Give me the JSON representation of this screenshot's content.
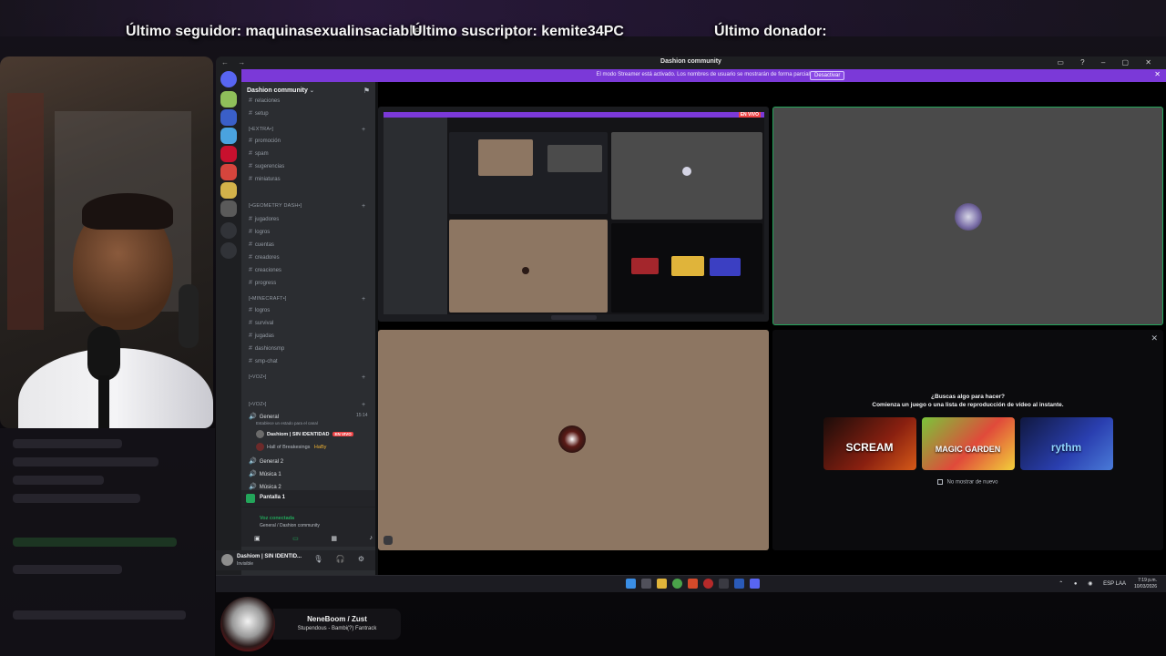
{
  "overlay": {
    "last_follower": "Último seguidor: maquinasexualinsaciable",
    "last_subscriber": "Último suscriptor: kemite34PC",
    "last_donor": "Último donador:"
  },
  "window": {
    "title": "Dashion community",
    "nav": "← →"
  },
  "banner": {
    "text": "El modo Streamer está activado. Los nombres de usuario se mostrarán de forma parcial.",
    "button": "Desactivar",
    "close": "✕"
  },
  "server": {
    "name": "Dashion community",
    "chevron": "⌄"
  },
  "channels": [
    {
      "kind": "text",
      "label": "relaciones"
    },
    {
      "kind": "text",
      "label": "setup"
    },
    {
      "kind": "cat",
      "label": "[•EXTRA•]"
    },
    {
      "kind": "text",
      "label": "promoción"
    },
    {
      "kind": "text",
      "label": "spam"
    },
    {
      "kind": "text",
      "label": "sugerencias"
    },
    {
      "kind": "text",
      "label": "miniaturas"
    },
    {
      "kind": "cat",
      "label": "[•GEOMETRY DASH•]"
    },
    {
      "kind": "text",
      "label": "jugadores"
    },
    {
      "kind": "text",
      "label": "logros"
    },
    {
      "kind": "text",
      "label": "cuentas"
    },
    {
      "kind": "text",
      "label": "creadores"
    },
    {
      "kind": "text",
      "label": "creaciones"
    },
    {
      "kind": "text",
      "label": "progress"
    },
    {
      "kind": "cat",
      "label": "[•MINECRAFT•]"
    },
    {
      "kind": "text",
      "label": "logros"
    },
    {
      "kind": "text",
      "label": "survival"
    },
    {
      "kind": "text",
      "label": "jugadas"
    },
    {
      "kind": "text",
      "label": "dashionsmp"
    },
    {
      "kind": "text",
      "label": "smp-chat"
    },
    {
      "kind": "cat",
      "label": "[•VOZ•]"
    },
    {
      "kind": "cat",
      "label": "[•VOZ•]"
    }
  ],
  "voice": {
    "general_label": "General",
    "general_time": "15:14",
    "general_status": "Establece un estado para el canal",
    "user1": "Dashiom | SIN IDENTIDAD",
    "user1_badge": "EN VIVO",
    "user2": "Hall of Breakesings",
    "user2_tag": "HaBy",
    "general2": "General 2",
    "music1": "Música 1",
    "music2": "Música 2"
  },
  "screen_panel": {
    "label": "Pantalla 1"
  },
  "voice_panel": {
    "title": "Voz conectada",
    "subtitle": "General / Dashion community"
  },
  "user_panel": {
    "name": "Dashiom | SIN IDENTID...",
    "status": "Invisible"
  },
  "mini": {
    "live": "EN VIVO"
  },
  "promo": {
    "title": "¿Buscas algo para hacer?",
    "subtitle": "Comienza un juego o una lista de reproducción de vídeo al instante.",
    "card1": "SCREAM",
    "card2": "MAGIC GARDEN",
    "card3": "rythm",
    "hide": "No mostrar de nuevo",
    "close": "✕"
  },
  "taskbar": {
    "lang": "ESP LAA",
    "time": "7:19 p.m.",
    "date": "10/03/2026"
  },
  "now_playing": {
    "artist": "NeneBoom / Zust",
    "song": "Stupendous - Bambi(?) Fantrack"
  },
  "colors": {
    "discord_purple": "#7b39d8",
    "discord_green": "#23a55a",
    "live_red": "#ed4245"
  }
}
